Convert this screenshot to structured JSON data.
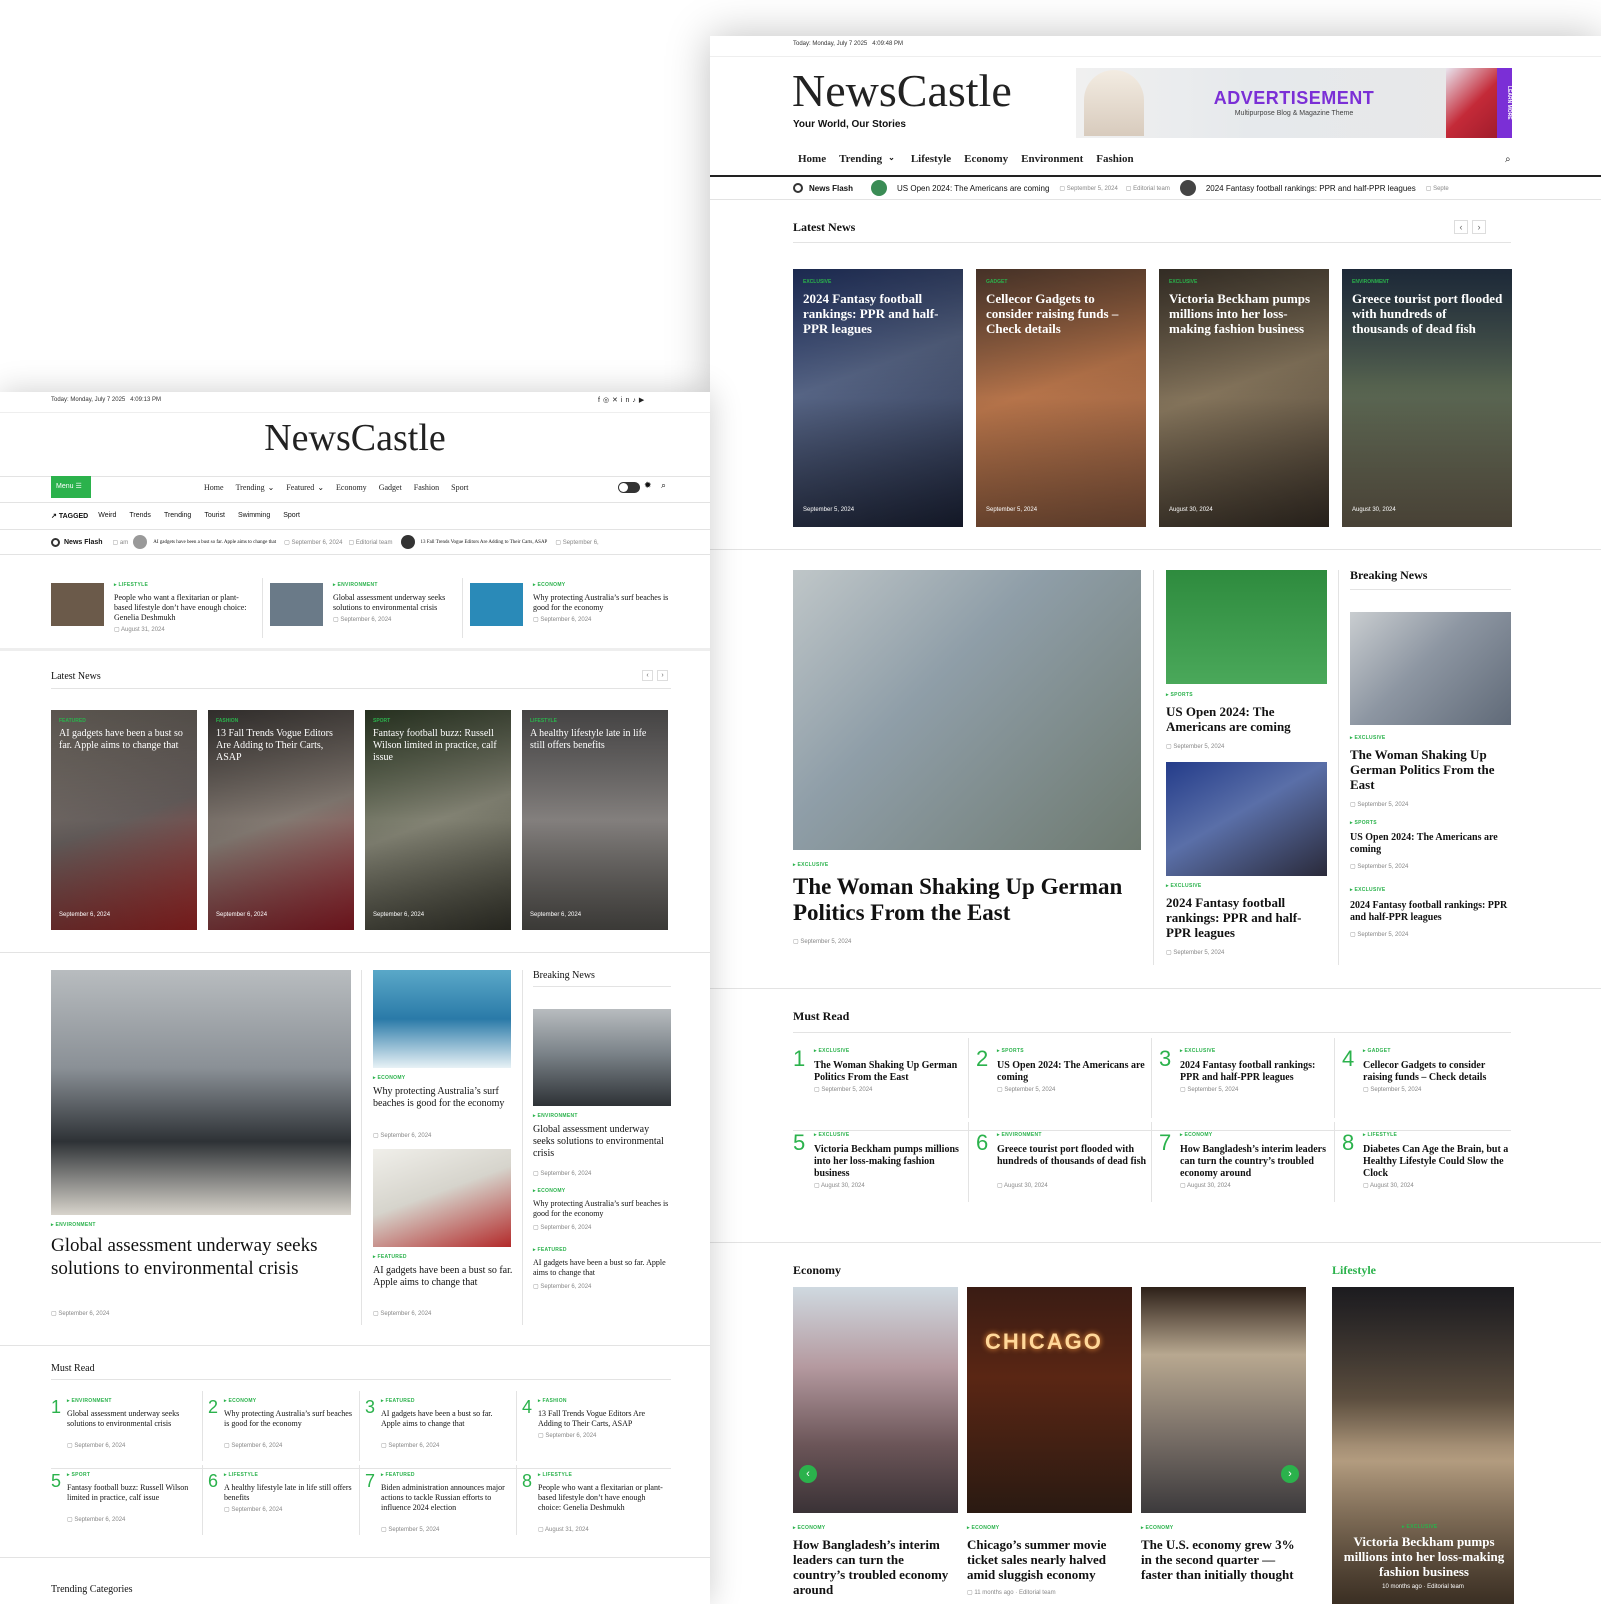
{
  "right": {
    "topbar": {
      "date": "Today: Monday, July 7 2025",
      "time": "4:09:48 PM"
    },
    "logo": "NewsCastle",
    "tagline": "Your World, Our Stories",
    "ad": {
      "title": "ADVERTISEMENT",
      "sub": "Multipurpose Blog & Magazine Theme",
      "side": "LEARN MORE"
    },
    "nav": [
      "Home",
      "Trending",
      "Lifestyle",
      "Economy",
      "Environment",
      "Fashion"
    ],
    "ticker": {
      "label": "News Flash",
      "items": [
        {
          "title": "US Open 2024: The Americans are coming",
          "date": "September 5, 2024",
          "author": "Editorial team"
        },
        {
          "title": "2024 Fantasy football rankings: PPR and half-PPR leagues",
          "date": "Septe"
        }
      ]
    },
    "latest": {
      "heading": "Latest News",
      "cards": [
        {
          "cat": "EXCLUSIVE",
          "title": "2024 Fantasy football rankings: PPR and half-PPR leagues",
          "date": "September 5, 2024"
        },
        {
          "cat": "GADGET",
          "title": "Cellecor Gadgets to consider raising funds – Check details",
          "date": "September 5, 2024"
        },
        {
          "cat": "EXCLUSIVE",
          "title": "Victoria Beckham pumps millions into her loss-making fashion business",
          "date": "August 30, 2024"
        },
        {
          "cat": "ENVIRONMENT",
          "title": "Greece tourist port flooded with hundreds of thousands of dead fish",
          "date": "August 30, 2024"
        }
      ]
    },
    "feature": {
      "cat": "EXCLUSIVE",
      "title": "The Woman Shaking Up German Politics From the East",
      "date": "September 5, 2024"
    },
    "mid": [
      {
        "cat": "SPORTS",
        "title": "US Open 2024: The Americans are coming",
        "date": "September 5, 2024"
      },
      {
        "cat": "EXCLUSIVE",
        "title": "2024 Fantasy football rankings: PPR and half-PPR leagues",
        "date": "September 5, 2024"
      }
    ],
    "breaking": {
      "heading": "Breaking News",
      "items": [
        {
          "cat": "EXCLUSIVE",
          "title": "The Woman Shaking Up German Politics From the East",
          "date": "September 5, 2024"
        },
        {
          "cat": "SPORTS",
          "title": "US Open 2024: The Americans are coming",
          "date": "September 5, 2024"
        },
        {
          "cat": "EXCLUSIVE",
          "title": "2024 Fantasy football rankings: PPR and half-PPR leagues",
          "date": "September 5, 2024"
        }
      ]
    },
    "mustread": {
      "heading": "Must Read",
      "items": [
        {
          "n": "1",
          "cat": "EXCLUSIVE",
          "title": "The Woman Shaking Up German Politics From the East",
          "date": "September 5, 2024"
        },
        {
          "n": "2",
          "cat": "SPORTS",
          "title": "US Open 2024: The Americans are coming",
          "date": "September 5, 2024"
        },
        {
          "n": "3",
          "cat": "EXCLUSIVE",
          "title": "2024 Fantasy football rankings: PPR and half-PPR leagues",
          "date": "September 5, 2024"
        },
        {
          "n": "4",
          "cat": "GADGET",
          "title": "Cellecor Gadgets to consider raising funds – Check details",
          "date": "September 5, 2024"
        },
        {
          "n": "5",
          "cat": "EXCLUSIVE",
          "title": "Victoria Beckham pumps millions into her loss-making fashion business",
          "date": "August 30, 2024"
        },
        {
          "n": "6",
          "cat": "ENVIRONMENT",
          "title": "Greece tourist port flooded with hundreds of thousands of dead fish",
          "date": "August 30, 2024"
        },
        {
          "n": "7",
          "cat": "ECONOMY",
          "title": "How Bangladesh’s interim leaders can turn the country’s troubled economy around",
          "date": "August 30, 2024"
        },
        {
          "n": "8",
          "cat": "LIFESTYLE",
          "title": "Diabetes Can Age the Brain, but a Healthy Lifestyle Could Slow the Clock",
          "date": "August 30, 2024"
        }
      ]
    },
    "economy": {
      "heading": "Economy",
      "items": [
        {
          "cat": "ECONOMY",
          "title": "How Bangladesh’s interim leaders can turn the country’s troubled economy around"
        },
        {
          "cat": "ECONOMY",
          "title": "Chicago’s summer movie ticket sales nearly halved amid sluggish economy",
          "date": "11 months ago",
          "author": "Editorial team",
          "sign": "CHICAGO"
        },
        {
          "cat": "ECONOMY",
          "title": "The U.S. economy grew 3% in the second quarter — faster than initially thought"
        }
      ]
    },
    "lifestyle": {
      "heading": "Lifestyle",
      "cat": "EXCLUSIVE",
      "title": "Victoria Beckham pumps millions into her loss-making fashion business",
      "date": "10 months ago",
      "author": "Editorial team"
    }
  },
  "left": {
    "topbar": {
      "date": "Today: Monday, July 7 2025",
      "time": "4:09:13 PM"
    },
    "logo": "NewsCastle",
    "menu": "Menu",
    "nav": [
      "Home",
      "Trending",
      "Featured",
      "Economy",
      "Gadget",
      "Fashion",
      "Sport"
    ],
    "tagged": {
      "label": "TAGGED",
      "tags": [
        "Weird",
        "Trends",
        "Trending",
        "Tourist",
        "Swimming",
        "Sport"
      ]
    },
    "ticker": {
      "label": "News Flash",
      "time": "am",
      "items": [
        {
          "title": "AI gadgets have been a bust so far. Apple aims to change that",
          "date": "September 6, 2024",
          "author": "Editorial team"
        },
        {
          "title": "13 Fall Trends Vogue Editors Are Adding to Their Carts, ASAP",
          "date": "September 6,"
        }
      ]
    },
    "strip": [
      {
        "cat": "LIFESTYLE",
        "title": "People who want a flexitarian or plant-based lifestyle don’t have enough choice: Genelia Deshmukh",
        "date": "August 31, 2024"
      },
      {
        "cat": "ENVIRONMENT",
        "title": "Global assessment underway seeks solutions to environmental crisis",
        "date": "September 6, 2024"
      },
      {
        "cat": "ECONOMY",
        "title": "Why protecting Australia’s surf beaches is good for the economy",
        "date": "September 6, 2024"
      }
    ],
    "latest": {
      "heading": "Latest News",
      "cards": [
        {
          "cat": "FEATURED",
          "title": "AI gadgets have been a bust so far. Apple aims to change that",
          "date": "September 6, 2024"
        },
        {
          "cat": "FASHION",
          "title": "13 Fall Trends Vogue Editors Are Adding to Their Carts, ASAP",
          "date": "September 6, 2024"
        },
        {
          "cat": "SPORT",
          "title": "Fantasy football buzz: Russell Wilson limited in practice, calf issue",
          "date": "September 6, 2024"
        },
        {
          "cat": "LIFESTYLE",
          "title": "A healthy lifestyle late in life still offers benefits",
          "date": "September 6, 2024"
        }
      ]
    },
    "feature": {
      "cat": "ENVIRONMENT",
      "title": "Global assessment underway seeks solutions to environmental crisis",
      "date": "September 6, 2024"
    },
    "mid": [
      {
        "cat": "ECONOMY",
        "title": "Why protecting Australia’s surf beaches is good for the economy",
        "date": "September 6, 2024"
      },
      {
        "cat": "FEATURED",
        "title": "AI gadgets have been a bust so far. Apple aims to change that",
        "date": "September 6, 2024"
      }
    ],
    "breaking": {
      "heading": "Breaking News",
      "items": [
        {
          "cat": "ENVIRONMENT",
          "title": "Global assessment underway seeks solutions to environmental crisis",
          "date": "September 6, 2024"
        },
        {
          "cat": "ECONOMY",
          "title": "Why protecting Australia’s surf beaches is good for the economy",
          "date": "September 6, 2024"
        },
        {
          "cat": "FEATURED",
          "title": "AI gadgets have been a bust so far. Apple aims to change that",
          "date": "September 6, 2024"
        }
      ]
    },
    "mustread": {
      "heading": "Must Read",
      "items": [
        {
          "n": "1",
          "cat": "ENVIRONMENT",
          "title": "Global assessment underway seeks solutions to environmental crisis",
          "date": "September 6, 2024"
        },
        {
          "n": "2",
          "cat": "ECONOMY",
          "title": "Why protecting Australia’s surf beaches is good for the economy",
          "date": "September 6, 2024"
        },
        {
          "n": "3",
          "cat": "FEATURED",
          "title": "AI gadgets have been a bust so far. Apple aims to change that",
          "date": "September 6, 2024"
        },
        {
          "n": "4",
          "cat": "FASHION",
          "title": "13 Fall Trends Vogue Editors Are Adding to Their Carts, ASAP",
          "date": "September 6, 2024"
        },
        {
          "n": "5",
          "cat": "SPORT",
          "title": "Fantasy football buzz: Russell Wilson limited in practice, calf issue",
          "date": "September 6, 2024"
        },
        {
          "n": "6",
          "cat": "LIFESTYLE",
          "title": "A healthy lifestyle late in life still offers benefits",
          "date": "September 6, 2024"
        },
        {
          "n": "7",
          "cat": "FEATURED",
          "title": "Biden administration announces major actions to tackle Russian efforts to influence 2024 election",
          "date": "September 5, 2024"
        },
        {
          "n": "8",
          "cat": "LIFESTYLE",
          "title": "People who want a flexitarian or plant-based lifestyle don’t have enough choice: Genelia Deshmukh",
          "date": "August 31, 2024"
        }
      ]
    },
    "trending": {
      "heading": "Trending Categories"
    }
  },
  "colors": {
    "accent": "#2bb24c",
    "ad_purple": "#7b2fd6"
  }
}
